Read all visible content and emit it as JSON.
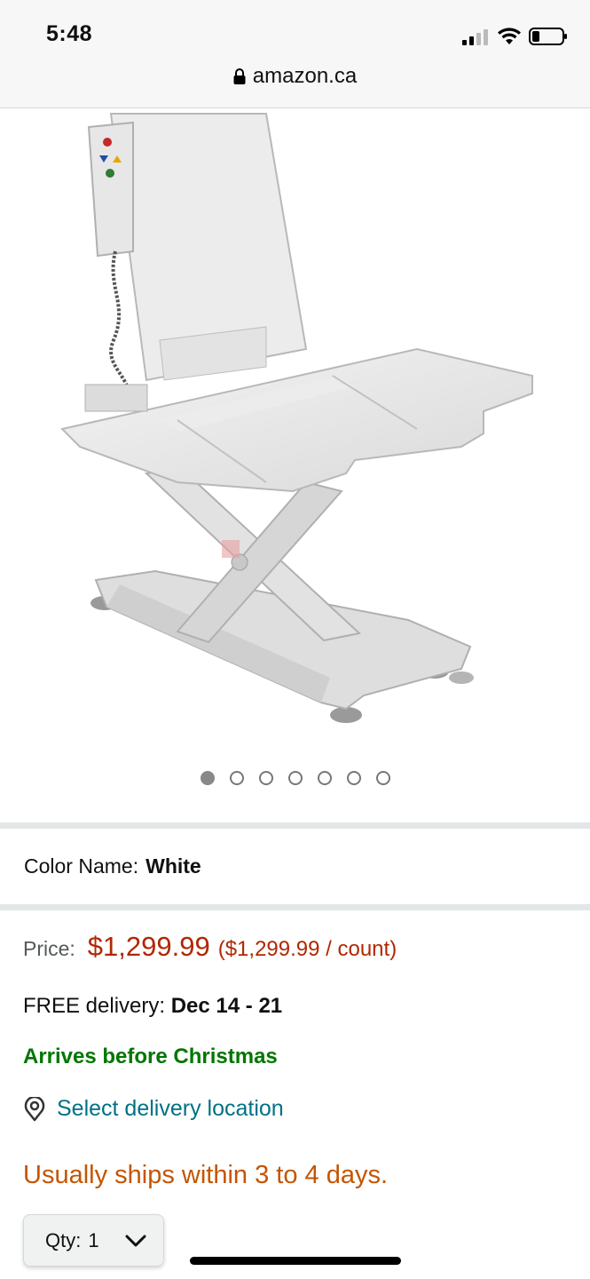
{
  "status_bar": {
    "time": "5:48"
  },
  "browser": {
    "url": "amazon.ca"
  },
  "product": {
    "image_alt": "White bath lift chair",
    "image_count": 7,
    "active_image_index": 0
  },
  "variation": {
    "label": "Color Name:",
    "value": "White"
  },
  "pricing": {
    "label": "Price:",
    "price": "$1,299.99",
    "unit_price": "($1,299.99 / count)"
  },
  "delivery": {
    "label": "FREE delivery:",
    "dates": "Dec 14 - 21",
    "arrives_note": "Arrives before Christmas",
    "location_link": "Select delivery location"
  },
  "availability": "Usually ships within 3 to 4 days.",
  "quantity": {
    "label": "Qty:",
    "value": "1"
  },
  "colors": {
    "price_red": "#b12704",
    "link_teal": "#007185",
    "success_green": "#007600",
    "ships_orange": "#c45500"
  }
}
